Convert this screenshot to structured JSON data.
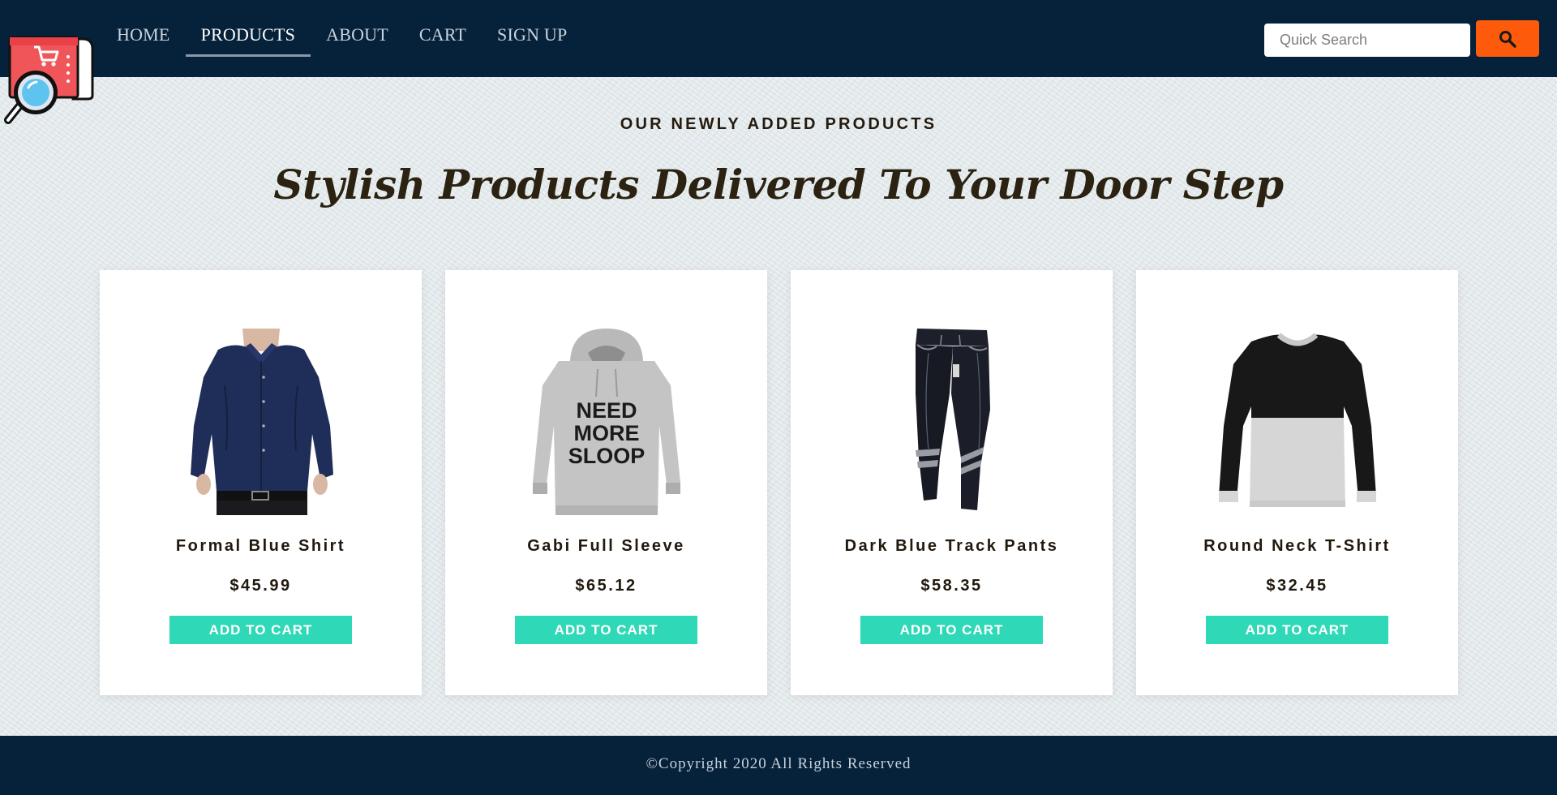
{
  "nav": {
    "items": [
      {
        "label": "HOME",
        "active": false
      },
      {
        "label": "PRODUCTS",
        "active": true
      },
      {
        "label": "ABOUT",
        "active": false
      },
      {
        "label": "CART",
        "active": false
      },
      {
        "label": "SIGN UP",
        "active": false
      }
    ]
  },
  "search": {
    "placeholder": "Quick Search",
    "value": "",
    "button_icon": "search-icon"
  },
  "logo_icon": "shop-search-logo-icon",
  "section": {
    "subtitle": "OUR NEWLY ADDED PRODUCTS",
    "headline": "Stylish Products Delivered To Your Door Step"
  },
  "products": [
    {
      "name": "Formal Blue Shirt",
      "price": "$45.99",
      "button": "ADD TO CART",
      "image": "shirt-image"
    },
    {
      "name": "Gabi Full Sleeve",
      "price": "$65.12",
      "button": "ADD TO CART",
      "image": "hoodie-image"
    },
    {
      "name": "Dark Blue Track Pants",
      "price": "$58.35",
      "button": "ADD TO CART",
      "image": "track-pants-image"
    },
    {
      "name": "Round Neck T-Shirt",
      "price": "$32.45",
      "button": "ADD TO CART",
      "image": "tshirt-image"
    }
  ],
  "hoodie_print": [
    "NEED",
    "MORE",
    "SLOOP"
  ],
  "footer": {
    "text": "©Copyright 2020 All Rights Reserved"
  },
  "colors": {
    "header_bg": "#06213a",
    "accent_orange": "#fe5a0b",
    "button_teal": "#2fd9b8",
    "text_dark": "#22190d"
  }
}
